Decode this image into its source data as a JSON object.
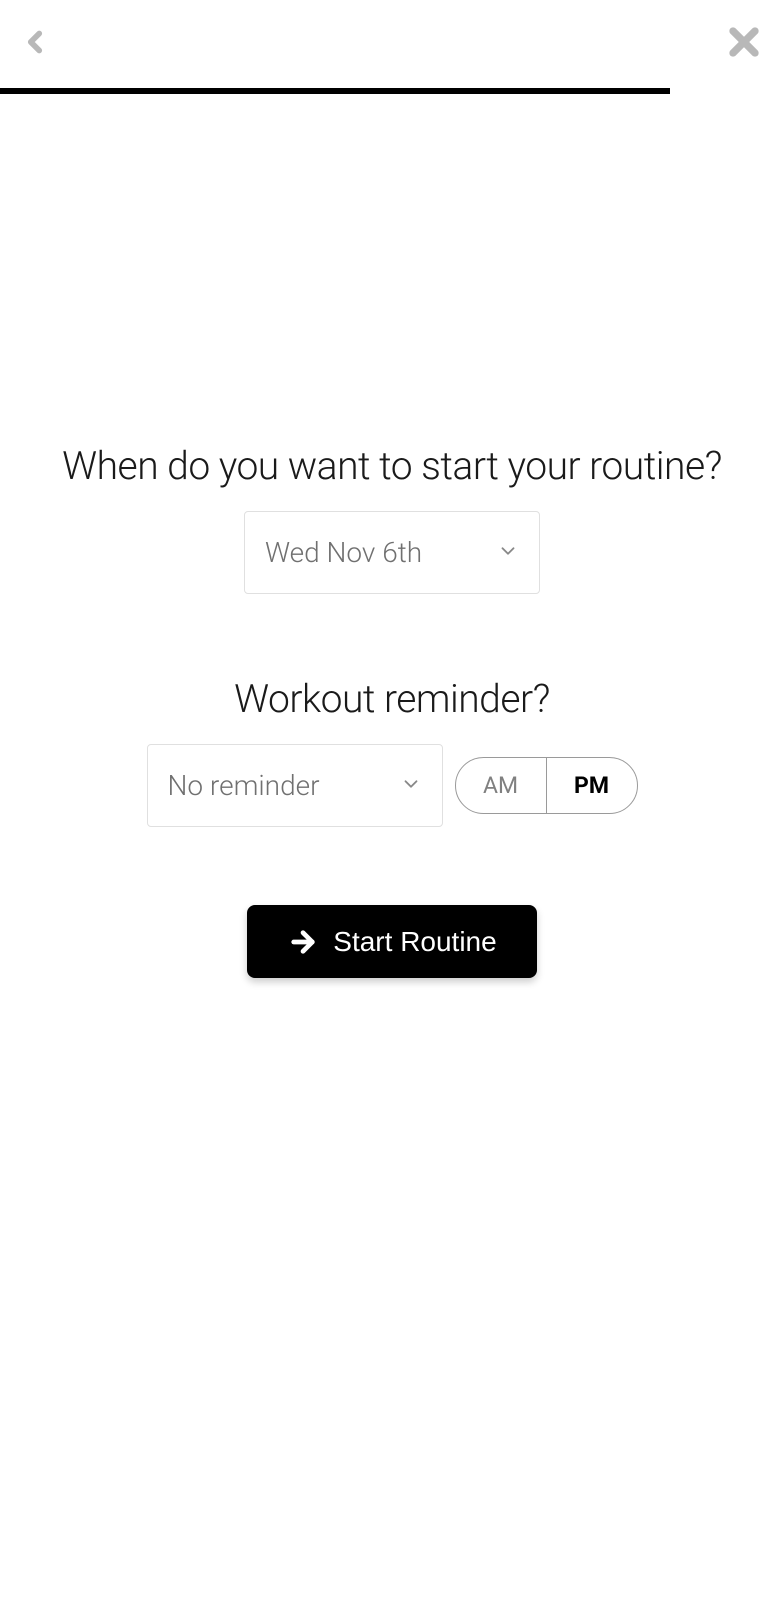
{
  "header": {
    "progress_percent": 85.5
  },
  "content": {
    "start_question": "When do you want to start your routine?",
    "date_value": "Wed Nov 6th",
    "reminder_question": "Workout reminder?",
    "reminder_value": "No reminder",
    "am_label": "AM",
    "pm_label": "PM",
    "selected_period": "PM",
    "start_button_label": "Start Routine"
  }
}
